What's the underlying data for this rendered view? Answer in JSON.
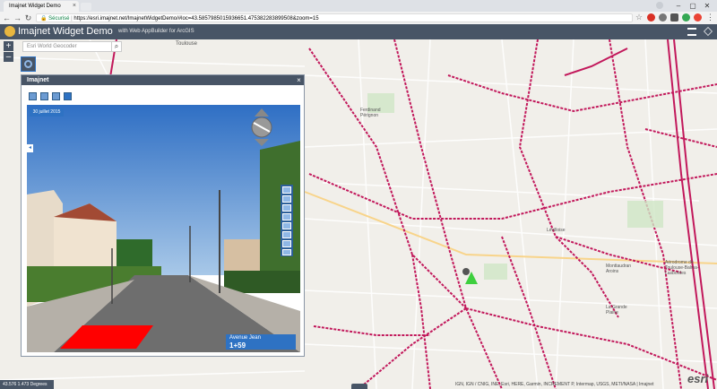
{
  "browser": {
    "tab_title": "Imajnet Widget Demo",
    "tab_close": "×",
    "security_label": "Sécurisé",
    "separator": "|",
    "url": "https://esri.imajnet.net/ImajnetWidgetDemo/#loc=43.5857985015936651.475382283899508&zoom=15",
    "window_controls": [
      "–",
      "▢",
      "✕"
    ]
  },
  "app": {
    "title": "Imajnet Widget Demo",
    "subtitle": "with Web AppBuilder for ArcGIS"
  },
  "search": {
    "placeholder": "Esri World Geocoder",
    "button_glyph": "⌕"
  },
  "map": {
    "zoom_in": "+",
    "zoom_out": "–",
    "labels": [
      "Toulouse",
      "Ferdinand Pérignon",
      "Lévilloise",
      "Monttaudran Aroins",
      "La Grande Plaine",
      "Aérodrome de Toulouse-Balma-Lasbordes"
    ]
  },
  "panel": {
    "title": "Imajnet",
    "close": "×",
    "date": "30 juillet 2015",
    "street_name": "Avenue Jean",
    "distance": "1+59"
  },
  "status": {
    "coords": "43.576 1.473 Degrees",
    "attribution": "IGN, IGN / CNIG, INE, Esri, HERE, Garmin, INCREMENT P, Intermap, USGS, METI/NASA | Imajnet",
    "esri": "esri"
  },
  "colors": {
    "header_bg": "#485566",
    "road_highlight": "#c2185b",
    "accent_blue": "#2e72c3",
    "selection_red": "#ff0000",
    "marker_green": "#3ecf3e"
  }
}
